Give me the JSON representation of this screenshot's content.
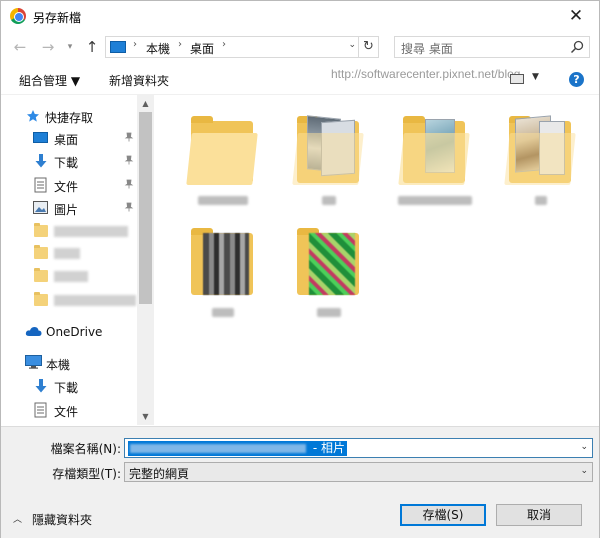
{
  "window": {
    "title": "另存新檔",
    "close_glyph": "✕"
  },
  "nav": {
    "back_glyph": "←",
    "forward_glyph": "→",
    "recent_glyph": "▾",
    "up_glyph": "↑",
    "breadcrumbs": [
      "本機",
      "桌面"
    ],
    "separator": "›",
    "dropdown_glyph": "⌄",
    "refresh_glyph": "↻"
  },
  "search": {
    "placeholder": "搜尋 桌面"
  },
  "toolbar": {
    "organize_label": "組合管理 ▼",
    "new_folder_label": "新增資料夾",
    "watermark": "http://softwarecenter.pixnet.net/blog",
    "view_drop_glyph": "▼",
    "help_glyph": "?"
  },
  "sidebar": {
    "quick_access_label": "快捷存取",
    "pinned": [
      {
        "label": "桌面",
        "icon": "desktop-icon"
      },
      {
        "label": "下載",
        "icon": "download-icon"
      },
      {
        "label": "文件",
        "icon": "documents-icon"
      },
      {
        "label": "圖片",
        "icon": "pictures-icon"
      }
    ],
    "onedrive_label": "OneDrive",
    "this_pc_label": "本機",
    "pc_items": [
      {
        "label": "下載",
        "icon": "download-icon"
      },
      {
        "label": "文件",
        "icon": "documents-icon"
      }
    ],
    "scroll_up_glyph": "▲",
    "scroll_down_glyph": "▼"
  },
  "footer": {
    "filename_label": "檔案名稱(N):",
    "filename_suffix": " - 相片",
    "filetype_label": "存檔類型(T):",
    "filetype_value": "完整的網頁",
    "dropdown_glyph": "⌄",
    "hide_folders_label": "隱藏資料夾",
    "hide_folders_glyph": "︿",
    "save_label": "存檔(S)",
    "cancel_label": "取消"
  },
  "colors": {
    "accent": "#0078d7",
    "folder": "#f0c458",
    "help": "#1b74c9"
  }
}
